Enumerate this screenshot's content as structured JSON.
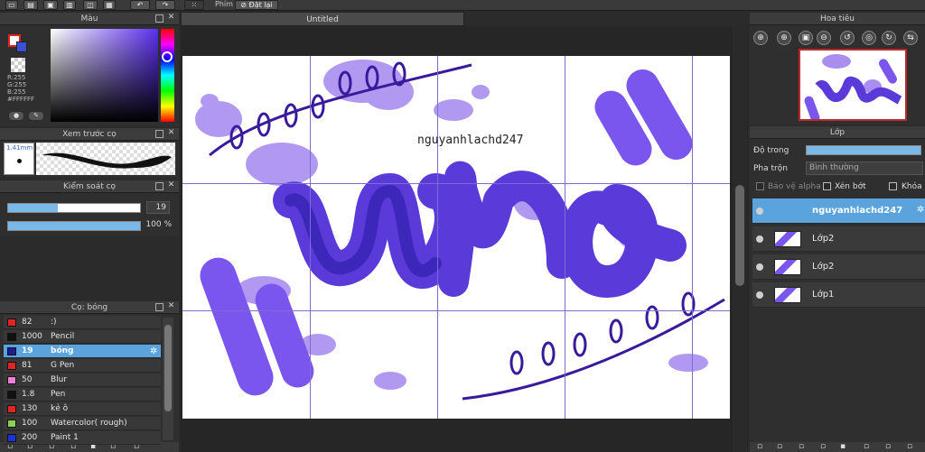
{
  "toolbar": {
    "mode_label": "Phím",
    "reset_label": "Đặt lại"
  },
  "canvas": {
    "tab_title": "Untitled",
    "watermark": "nguyanhlachd247"
  },
  "color_panel": {
    "title": "Màu",
    "r": "R:255",
    "g": "G:255",
    "b": "B:255",
    "hex": "#FFFFFF",
    "fg": "#e0221f",
    "bg": "#3b50d8"
  },
  "brush_preview": {
    "title": "Xem trước cọ",
    "size": "1.41mm"
  },
  "brush_control": {
    "title": "Kiểm soát cọ",
    "size_value": "19",
    "opacity_value": "100 %"
  },
  "brush_list": {
    "title": "Cọ: bóng",
    "items": [
      {
        "size": "82",
        "name": ":)",
        "color": "#e02323"
      },
      {
        "size": "1000",
        "name": "Pencil",
        "color": "#111111"
      },
      {
        "size": "19",
        "name": "bóng",
        "color": "#1c1c9a"
      },
      {
        "size": "81",
        "name": "G Pen",
        "color": "#e02323"
      },
      {
        "size": "50",
        "name": "Blur",
        "color": "#f07ed8"
      },
      {
        "size": "1.8",
        "name": "Pen",
        "color": "#111111"
      },
      {
        "size": "130",
        "name": "kẻ ô",
        "color": "#e02323"
      },
      {
        "size": "100",
        "name": "Watercolor( rough)",
        "color": "#8ccf55"
      },
      {
        "size": "200",
        "name": "Paint 1",
        "color": "#1a33d8"
      }
    ]
  },
  "navigator": {
    "title": "Hoa tiêu"
  },
  "layers_panel": {
    "title": "Lớp",
    "opacity_label": "Độ trong",
    "blend_label": "Pha trộn",
    "blend_value": "Bình thường",
    "protect_alpha": "Bảo vệ alpha",
    "clip": "Xén bớt",
    "lock": "Khóa",
    "layers": [
      {
        "name": "nguyanhlachd247"
      },
      {
        "name": "Lớp2"
      },
      {
        "name": "Lớp2"
      },
      {
        "name": "Lớp1"
      }
    ]
  },
  "accent": "#5aa3dc"
}
